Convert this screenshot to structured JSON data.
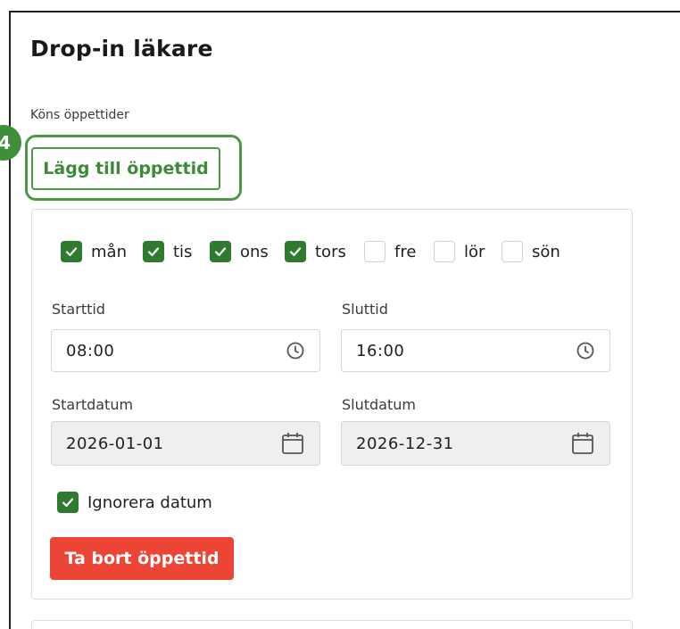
{
  "page": {
    "title": "Drop-in läkare",
    "section_label": "Köns öppettider",
    "step_badge": "4"
  },
  "add_button": {
    "label": "Lägg till öppettid"
  },
  "weekdays": [
    {
      "label": "mån",
      "checked": true
    },
    {
      "label": "tis",
      "checked": true
    },
    {
      "label": "ons",
      "checked": true
    },
    {
      "label": "tors",
      "checked": true
    },
    {
      "label": "fre",
      "checked": false
    },
    {
      "label": "lör",
      "checked": false
    },
    {
      "label": "sön",
      "checked": false
    }
  ],
  "start_time": {
    "label": "Starttid",
    "value": "08:00",
    "icon": "clock-icon"
  },
  "end_time": {
    "label": "Sluttid",
    "value": "16:00",
    "icon": "clock-icon"
  },
  "start_date": {
    "label": "Startdatum",
    "value": "2026-01-01",
    "icon": "calendar-icon"
  },
  "end_date": {
    "label": "Slutdatum",
    "value": "2026-12-31",
    "icon": "calendar-icon"
  },
  "ignore_dates": {
    "label": "Ignorera datum",
    "checked": true
  },
  "remove_button": {
    "label": "Ta bort öppettid"
  },
  "colors": {
    "accent_green": "#4a9a43",
    "checkbox_green": "#2f7a2f",
    "danger_red": "#ec4536",
    "disabled_bg": "#efefef"
  }
}
